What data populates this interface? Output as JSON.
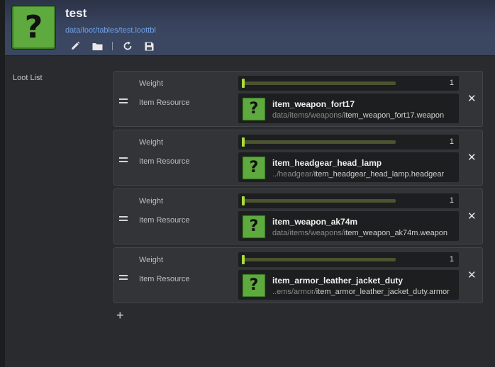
{
  "header": {
    "title": "test",
    "path": "data/loot/tables/test.loottbl",
    "toolbar": [
      {
        "name": "edit-button",
        "icon": "pencil-icon"
      },
      {
        "name": "open-folder-button",
        "icon": "folder-icon"
      },
      {
        "name": "reload-button",
        "icon": "refresh-icon"
      },
      {
        "name": "save-button",
        "icon": "floppy-disk-icon"
      }
    ]
  },
  "loot_list": {
    "label": "Loot List",
    "add_symbol": "+",
    "entries": [
      {
        "weight_label": "Weight",
        "weight": "1",
        "weight_fraction": 0.0,
        "resource_label": "Item Resource",
        "resource_icon": "?",
        "name": "item_weapon_fort17",
        "dir": "data/items/weapons/",
        "file": "item_weapon_fort17.weapon",
        "remove_symbol": "✕"
      },
      {
        "weight_label": "Weight",
        "weight": "1",
        "weight_fraction": 0.0,
        "resource_label": "Item Resource",
        "resource_icon": "?",
        "name": "item_headgear_head_lamp",
        "dir": "../headgear/",
        "file": "item_headgear_head_lamp.headgear",
        "remove_symbol": "✕"
      },
      {
        "weight_label": "Weight",
        "weight": "1",
        "weight_fraction": 0.0,
        "resource_label": "Item Resource",
        "resource_icon": "?",
        "name": "item_weapon_ak74m",
        "dir": "data/items/weapons/",
        "file": "item_weapon_ak74m.weapon",
        "remove_symbol": "✕"
      },
      {
        "weight_label": "Weight",
        "weight": "1",
        "weight_fraction": 0.0,
        "resource_label": "Item Resource",
        "resource_icon": "?",
        "name": "item_armor_leather_jacket_duty",
        "dir": "..ems/armor/",
        "file": "item_armor_leather_jacket_duty.armor",
        "remove_symbol": "✕"
      }
    ]
  },
  "header_icon": "?",
  "colors": {
    "accent_green": "#a9dd3c",
    "icon_green": "#5eaa3e",
    "path_blue": "#6fa3e8",
    "header_blue": "#3b4660"
  }
}
